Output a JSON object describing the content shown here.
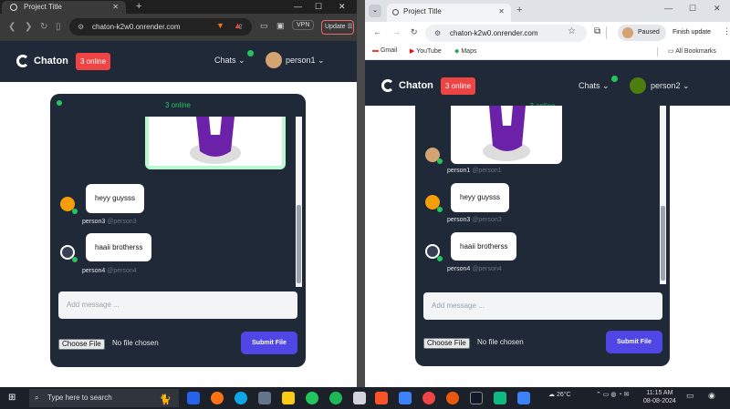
{
  "left_browser": {
    "tab_title": "Project Title",
    "url": "chaton-k2w0.onrender.com",
    "vpn_label": "VPN",
    "update_label": "Update"
  },
  "right_browser": {
    "tab_title": "Project Title",
    "url": "chaton-k2w0.onrender.com",
    "paused_label": "Paused",
    "finish_update_label": "Finish update",
    "bookmarks": [
      "Gmail",
      "YouTube",
      "Maps"
    ],
    "all_bookmarks": "All Bookmarks"
  },
  "left_app": {
    "brand": "Chaton",
    "online_badge": "3 online",
    "chats_label": "Chats",
    "username": "person1",
    "panel_online": "3 online",
    "messages": [
      {
        "text": "heyy guysss",
        "name": "person3",
        "handle": "@person3"
      },
      {
        "text": "haaii brotherss",
        "name": "person4",
        "handle": "@person4"
      }
    ],
    "input_placeholder": "Add message ...",
    "choose_file": "Choose File",
    "no_file": "No file chosen",
    "submit": "Submit File"
  },
  "right_app": {
    "brand": "Chaton",
    "online_badge": "3 online",
    "chats_label": "Chats",
    "username": "person2",
    "panel_online": "3 online",
    "image_sender": {
      "name": "person1",
      "handle": "@person1"
    },
    "messages": [
      {
        "text": "heyy guysss",
        "name": "person3",
        "handle": "@person3"
      },
      {
        "text": "haaii brotherss",
        "name": "person4",
        "handle": "@person4"
      }
    ],
    "input_placeholder": "Add message ...",
    "choose_file": "Choose File",
    "no_file": "No file chosen",
    "submit": "Submit File"
  },
  "taskbar": {
    "search_placeholder": "Type here to search",
    "weather": "26°C",
    "time": "11:15 AM",
    "date": "08-08-2024"
  },
  "colors": {
    "accent": "#4f46e5",
    "online": "#22c55e",
    "badge": "#ef4444",
    "panel": "#1f2937"
  }
}
